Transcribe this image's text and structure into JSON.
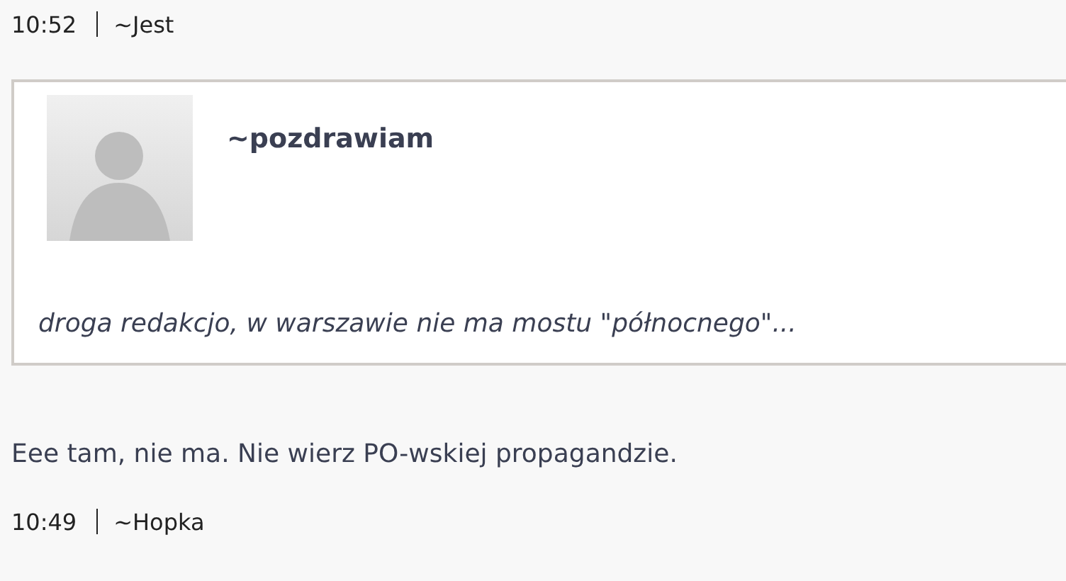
{
  "top_meta": {
    "time": "10:52",
    "author": "~Jest"
  },
  "quote": {
    "author": "~pozdrawiam",
    "text": "droga redakcjo, w warszawie nie ma mostu \"północnego\"..."
  },
  "comment": {
    "text": "Eee tam, nie ma. Nie wierz PO-wskiej propagandzie."
  },
  "bottom_meta": {
    "time": "10:49",
    "author": "~Hopka"
  }
}
